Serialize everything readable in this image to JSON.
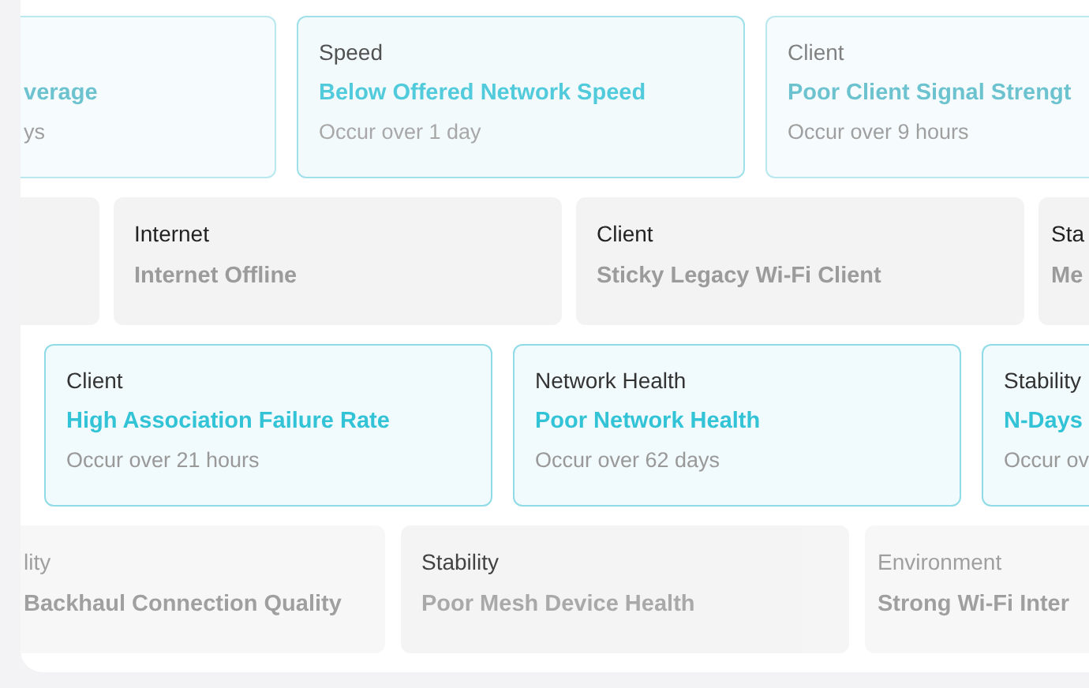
{
  "rows": [
    {
      "dimmed": true,
      "cards": [
        {
          "kind": "active",
          "faded": true,
          "headline": "verage",
          "occurrence": "ys"
        },
        {
          "kind": "active",
          "faded": false,
          "title": "Speed",
          "headline": "Below Offered Network Speed",
          "occurrence": "Occur over 1 day"
        },
        {
          "kind": "active",
          "faded": true,
          "title": "Client",
          "headline": "Poor Client Signal Strengt",
          "occurrence": "Occur over 9 hours"
        }
      ]
    },
    {
      "dimmed": false,
      "cards": [
        {
          "kind": "inactive"
        },
        {
          "kind": "inactive",
          "faded": false,
          "title": "Internet",
          "headline": "Internet Offline"
        },
        {
          "kind": "inactive",
          "faded": false,
          "title": "Client",
          "headline": "Sticky Legacy Wi-Fi Client"
        },
        {
          "kind": "inactive",
          "faded": false,
          "title": "Sta",
          "headline": "Me"
        }
      ]
    },
    {
      "dimmed": false,
      "cards": [
        {
          "kind": "active",
          "faded": false,
          "title": "Client",
          "headline": "High Association Failure Rate",
          "occurrence": "Occur over 21 hours"
        },
        {
          "kind": "active",
          "faded": false,
          "title": "Network Health",
          "headline": "Poor Network Health",
          "occurrence": "Occur over 62 days"
        },
        {
          "kind": "active",
          "faded": false,
          "title": "Stability",
          "headline": "N-Days",
          "occurrence": "Occur ov"
        }
      ]
    },
    {
      "dimmed": true,
      "cards": [
        {
          "kind": "inactive",
          "faded": true,
          "title": "lity",
          "headline": "Backhaul Connection Quality"
        },
        {
          "kind": "inactive",
          "faded": false,
          "title": "Stability",
          "headline": "Poor Mesh Device Health"
        },
        {
          "kind": "inactive",
          "faded": true,
          "title": "Environment",
          "headline": "Strong Wi-Fi Inter"
        }
      ]
    }
  ]
}
